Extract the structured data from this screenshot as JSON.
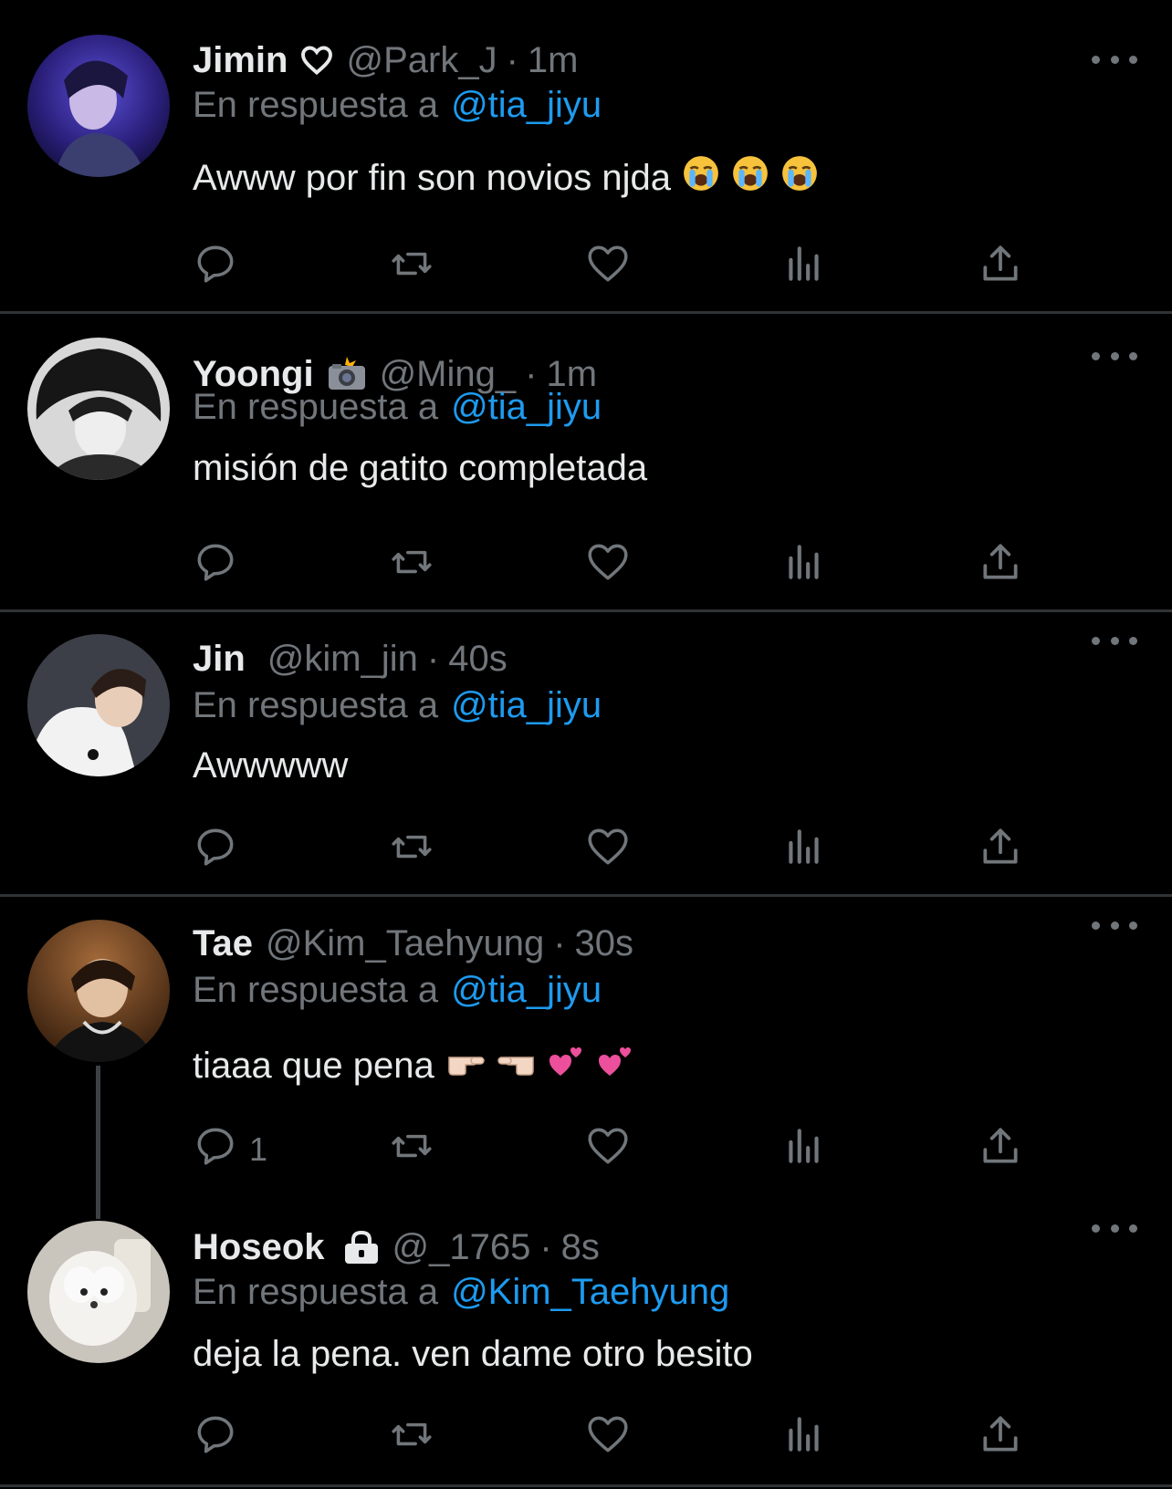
{
  "colors": {
    "background": "#000000",
    "text": "#e7e9ea",
    "muted": "#71767b",
    "link": "#1d9bf0",
    "divider": "#2f3336"
  },
  "replies": [
    {
      "name": "Jimin",
      "badge_icon": "heart-outline-icon",
      "handle": "@Park_J",
      "separator": "·",
      "time": "1m",
      "reply_prefix": "En respuesta a",
      "reply_to": "@tia_jiyu",
      "text": "Awww por fin son novios njda",
      "emojis": [
        "loudly-crying-face",
        "loudly-crying-face",
        "loudly-crying-face"
      ],
      "reply_count": ""
    },
    {
      "name": "Yoongi",
      "badge_icon": "camera-flash-icon",
      "handle": "@Ming_",
      "separator": "·",
      "time": "1m",
      "reply_prefix": "En respuesta a",
      "reply_to": "@tia_jiyu",
      "text": "misión de gatito completada",
      "emojis": [],
      "reply_count": ""
    },
    {
      "name": "Jin",
      "badge_icon": "",
      "handle": "@kim_jin",
      "separator": "·",
      "time": "40s",
      "reply_prefix": "En respuesta a",
      "reply_to": "@tia_jiyu",
      "text": "Awwwww",
      "emojis": [],
      "reply_count": ""
    },
    {
      "name": "Tae",
      "badge_icon": "",
      "handle": "@Kim_Taehyung",
      "separator": "·",
      "time": "30s",
      "reply_prefix": "En respuesta a",
      "reply_to": "@tia_jiyu",
      "text": "tiaaa que pena",
      "emojis": [
        "backhand-index-pointing-right",
        "backhand-index-pointing-left",
        "two-hearts",
        "two-hearts"
      ],
      "reply_count": "1"
    },
    {
      "name": "Hoseok",
      "badge_icon": "lock-icon",
      "handle": "@_1765",
      "separator": "·",
      "time": "8s",
      "reply_prefix": "En respuesta a",
      "reply_to": "@Kim_Taehyung",
      "text": "deja la pena. ven dame otro besito",
      "emojis": [],
      "reply_count": ""
    }
  ]
}
